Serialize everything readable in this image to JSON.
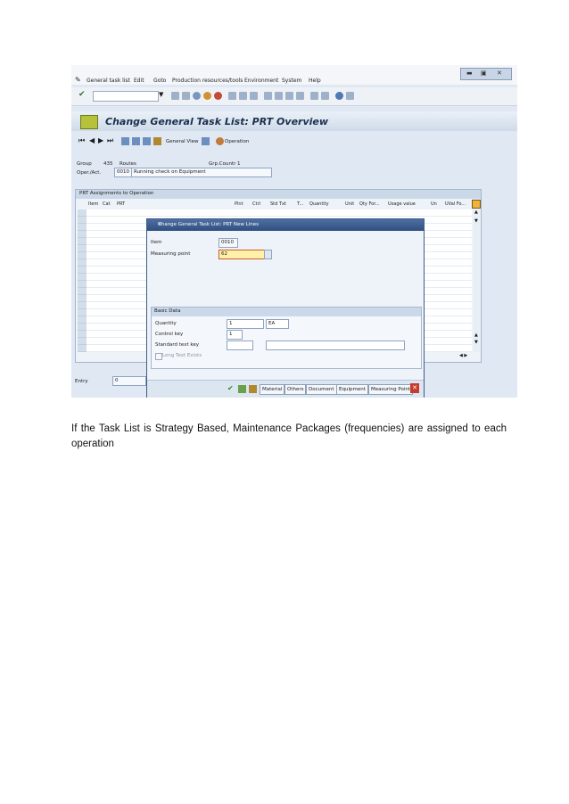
{
  "screenshot": {
    "menu": [
      "General task list",
      "Edit",
      "Goto",
      "Production resources/tools",
      "Environment",
      "System",
      "Help"
    ],
    "title": "Change General Task List: PRT Overview",
    "app_toolbar": {
      "general_view": "General View",
      "operation": "Operation"
    },
    "header": {
      "group_label": "Group",
      "group_value": "435",
      "group_text": "Routes",
      "grpcountr_label": "Grp.Countr",
      "grpcountr_value": "1",
      "oper_label": "Oper./Act.",
      "oper_value": "0010",
      "oper_text": "Running check on Equipment"
    },
    "prt_group": {
      "title": "PRT Assignments to Operation",
      "columns": [
        "Item",
        "Cat",
        "PRT",
        "Plnt",
        "Ctrl",
        "Std Txt",
        "T...",
        "Quantity",
        "Unit",
        "Qty For...",
        "Usage value",
        "Un",
        "UVal Fo..."
      ]
    },
    "entry": {
      "label": "Entry",
      "value": "0"
    },
    "dialog": {
      "title": "Change General Task List: PRT New Lines",
      "item_label": "Item",
      "item_value": "0010",
      "mpoint_label": "Measuring point",
      "mpoint_value": "62",
      "basic_data": "Basic Data",
      "qty_label": "Quantity",
      "qty_value": "1",
      "qty_unit": "EA",
      "ctrl_label": "Control key",
      "ctrl_value": "1",
      "std_label": "Standard text key",
      "long_text": "Long Text Exists",
      "buttons": [
        "Material",
        "Others",
        "Document",
        "Equipment",
        "Measuring Point"
      ]
    }
  },
  "caption": "If the Task List is Strategy Based, Maintenance Packages (frequencies) are assigned to each operation"
}
